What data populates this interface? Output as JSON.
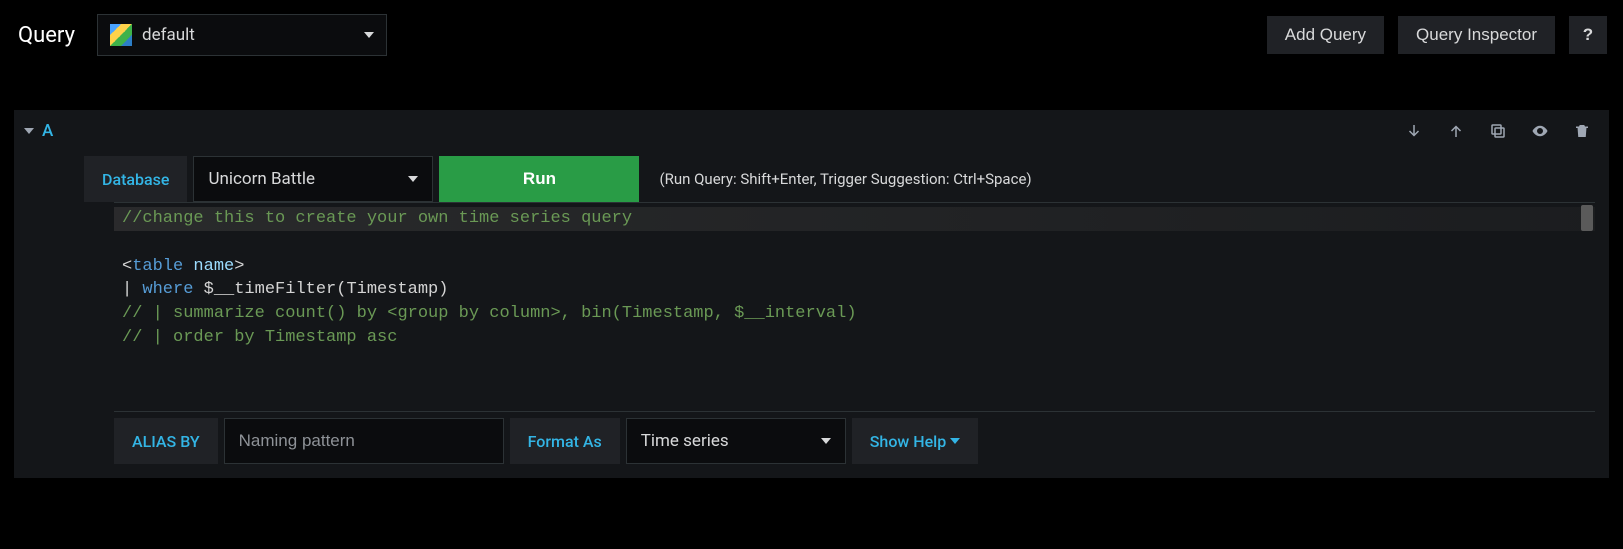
{
  "header": {
    "title": "Query",
    "datasource": "default",
    "add_query_label": "Add Query",
    "query_inspector_label": "Query Inspector",
    "help_label": "?"
  },
  "row": {
    "letter": "A"
  },
  "toolbar": {
    "database_label": "Database",
    "database_value": "Unicorn Battle",
    "run_label": "Run",
    "hint": "(Run Query: Shift+Enter, Trigger Suggestion: Ctrl+Space)"
  },
  "editor": {
    "line1": "//change this to create your own time series query",
    "line2": "",
    "line3_open": "<",
    "line3_kw": "table",
    "line3_sp": " ",
    "line3_name": "name",
    "line3_close": ">",
    "line4_pipe": "| ",
    "line4_kw": "where",
    "line4_rest": " $__timeFilter(Timestamp)",
    "line5": "// | summarize count() by <group by column>, bin(Timestamp, $__interval)",
    "line6": "// | order by Timestamp asc"
  },
  "bottom": {
    "alias_label": "ALIAS BY",
    "alias_placeholder": "Naming pattern",
    "format_label": "Format As",
    "format_value": "Time series",
    "show_help_label": "Show Help"
  }
}
